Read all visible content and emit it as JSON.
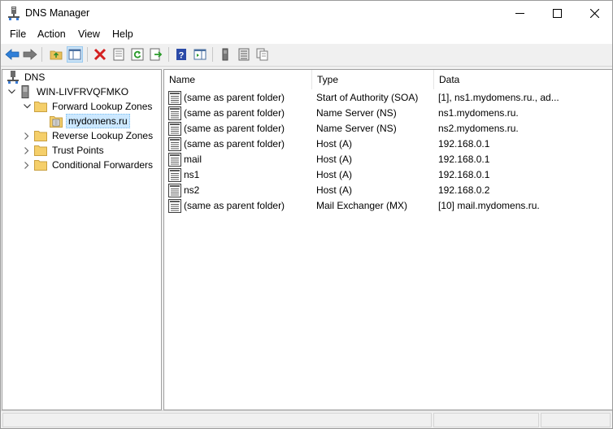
{
  "window": {
    "title": "DNS Manager"
  },
  "menu": [
    {
      "label": "File"
    },
    {
      "label": "Action"
    },
    {
      "label": "View"
    },
    {
      "label": "Help"
    }
  ],
  "tree": {
    "root": "DNS",
    "server": "WIN-LIVFRVQFMKO",
    "forward_zones": "Forward Lookup Zones",
    "zone": "mydomens.ru",
    "reverse_zones": "Reverse Lookup Zones",
    "trust_points": "Trust Points",
    "conditional_forwarders": "Conditional Forwarders"
  },
  "list": {
    "columns": {
      "name": "Name",
      "type": "Type",
      "data": "Data"
    },
    "rows": [
      {
        "name": "(same as parent folder)",
        "type": "Start of Authority (SOA)",
        "data": "[1], ns1.mydomens.ru., ad..."
      },
      {
        "name": "(same as parent folder)",
        "type": "Name Server (NS)",
        "data": "ns1.mydomens.ru."
      },
      {
        "name": "(same as parent folder)",
        "type": "Name Server (NS)",
        "data": "ns2.mydomens.ru."
      },
      {
        "name": "(same as parent folder)",
        "type": "Host (A)",
        "data": "192.168.0.1"
      },
      {
        "name": "mail",
        "type": "Host (A)",
        "data": "192.168.0.1"
      },
      {
        "name": "ns1",
        "type": "Host (A)",
        "data": "192.168.0.1"
      },
      {
        "name": "ns2",
        "type": "Host (A)",
        "data": "192.168.0.2"
      },
      {
        "name": "(same as parent folder)",
        "type": "Mail Exchanger (MX)",
        "data": "[10]  mail.mydomens.ru."
      }
    ]
  },
  "toolbar": [
    "back-icon",
    "forward-icon",
    "up-folder-icon",
    "show-hide-tree-icon",
    "delete-icon",
    "properties-icon",
    "refresh-icon",
    "export-list-icon",
    "help-icon",
    "action-pane-icon",
    "server-icon",
    "record-list-icon",
    "copy-icon"
  ],
  "colors": {
    "selection": "#cce8ff",
    "accent": "#1a6fc4",
    "folder": "#f5cf6a"
  }
}
